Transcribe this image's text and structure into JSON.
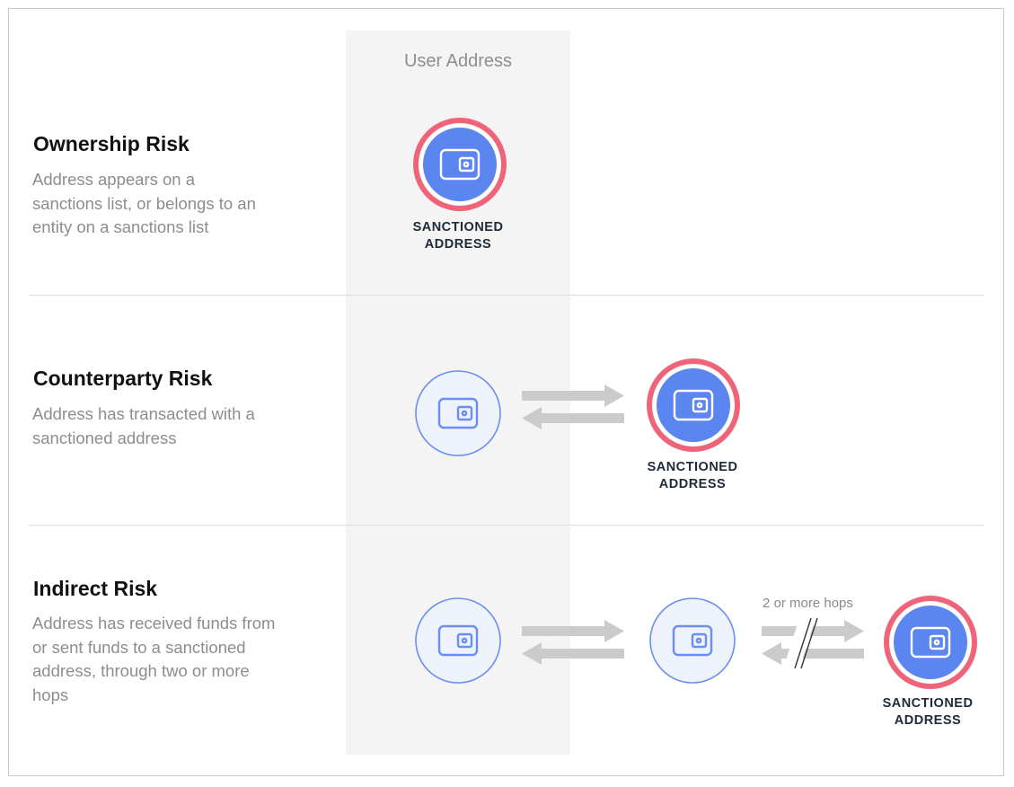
{
  "header": {
    "user_column_title": "User Address"
  },
  "rows": [
    {
      "title": "Ownership Risk",
      "description": "Address appears on a sanctions list, or belongs to an entity on a sanctions list",
      "nodes": [
        {
          "type": "sanctioned",
          "label": "SANCTIONED\nADDRESS"
        }
      ]
    },
    {
      "title": "Counterparty Risk",
      "description": "Address has transacted with a sanctioned address",
      "nodes": [
        {
          "type": "user"
        },
        {
          "type": "sanctioned",
          "label": "SANCTIONED\nADDRESS"
        }
      ]
    },
    {
      "title": "Indirect Risk",
      "description": "Address has received funds from or sent funds to a sanctioned address, through two or more hops",
      "hops_label": "2 or more hops",
      "nodes": [
        {
          "type": "user"
        },
        {
          "type": "intermediate"
        },
        {
          "type": "sanctioned",
          "label": "SANCTIONED\nADDRESS"
        }
      ]
    }
  ],
  "icons": {
    "wallet": "wallet-icon",
    "arrows": "bidirectional-arrows-icon",
    "broken_arrows": "broken-bidirectional-arrows-icon"
  },
  "colors": {
    "sanctioned_ring": "#f0647a",
    "sanctioned_fill": "#5b86ef",
    "node_outline": "#6a8ff0",
    "node_fill": "#eef2fb",
    "arrow": "#cbcbcb",
    "column_bg": "#f4f4f4"
  }
}
